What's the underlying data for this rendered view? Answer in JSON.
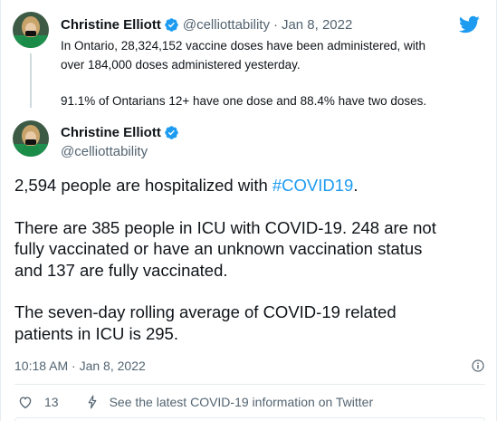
{
  "parent_tweet": {
    "name": "Christine Elliott",
    "handle": "@celliottability",
    "separator": "·",
    "date": "Jan 8, 2022",
    "lines": [
      "In Ontario, 28,324,152 vaccine doses have been administered, with",
      "over 184,000 doses administered yesterday."
    ],
    "second_paragraph": "91.1% of Ontarians 12+ have one dose and 88.4% have two doses."
  },
  "main_tweet": {
    "name": "Christine Elliott",
    "handle": "@celliottability",
    "para1_prefix": "2,594 people are hospitalized with ",
    "para1_hashtag": "#COVID19",
    "para1_suffix": ".",
    "para2_line1": "There are 385 people in ICU with COVID-19. 248 are not",
    "para2_line2": "fully vaccinated or have an unknown vaccination status",
    "para2_line3": "and 137 are fully vaccinated.",
    "para3_line1": "The seven-day rolling average of COVID-19 related",
    "para3_line2": "patients in ICU is 295.",
    "timestamp": "10:18 AM · Jan 8, 2022",
    "like_count": "13",
    "covid_link": "See the latest COVID-19 information on Twitter"
  },
  "icons": {
    "brand": "twitter-bird-icon",
    "verified": "verified-badge-icon",
    "info": "info-icon",
    "like": "heart-icon",
    "covid": "lightning-bolt-icon"
  },
  "colors": {
    "accent": "#1d9bf0",
    "text": "#0f1419",
    "secondary": "#536471",
    "avatar_bg": "#2e7a4f"
  }
}
